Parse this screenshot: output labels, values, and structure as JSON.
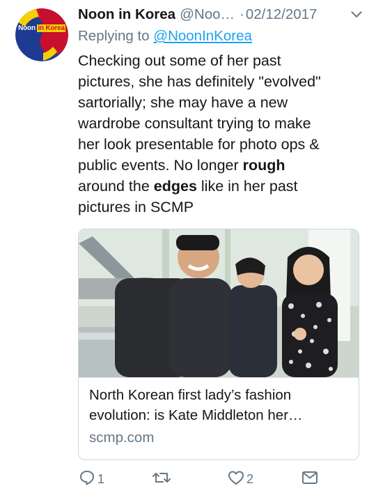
{
  "tweet": {
    "avatar_text_part1": "Noon",
    "avatar_text_part2": "in Korea",
    "display_name": "Noon in Korea",
    "handle": "@Noo…",
    "separator": "·",
    "date": "02/12/2017",
    "replying_prefix": "Replying to",
    "replying_handle": "@NoonInKorea",
    "text_lines": [
      "Checking out some of her past",
      "pictures, she has definitely \"evolved\"",
      "sartorially; she may have a new",
      "wardrobe consultant trying to make",
      "her look presentable for photo ops &",
      "public events.  No longer ",
      "rough",
      "around the ",
      "edges",
      " like in her past",
      "pictures in SCMP"
    ]
  },
  "card": {
    "title_line1": "North Korean first lady’s fashion",
    "title_line2": "evolution: is Kate Middleton her…",
    "domain": "scmp.com"
  },
  "actions": {
    "reply_count": "1",
    "like_count": "2"
  },
  "colors": {
    "text": "#14171a",
    "secondary": "#657786",
    "link": "#1da1f2",
    "border": "#ccd6dd"
  },
  "icons": [
    "chevron-down-icon",
    "reply-icon",
    "retweet-icon",
    "like-icon",
    "direct-message-icon"
  ]
}
